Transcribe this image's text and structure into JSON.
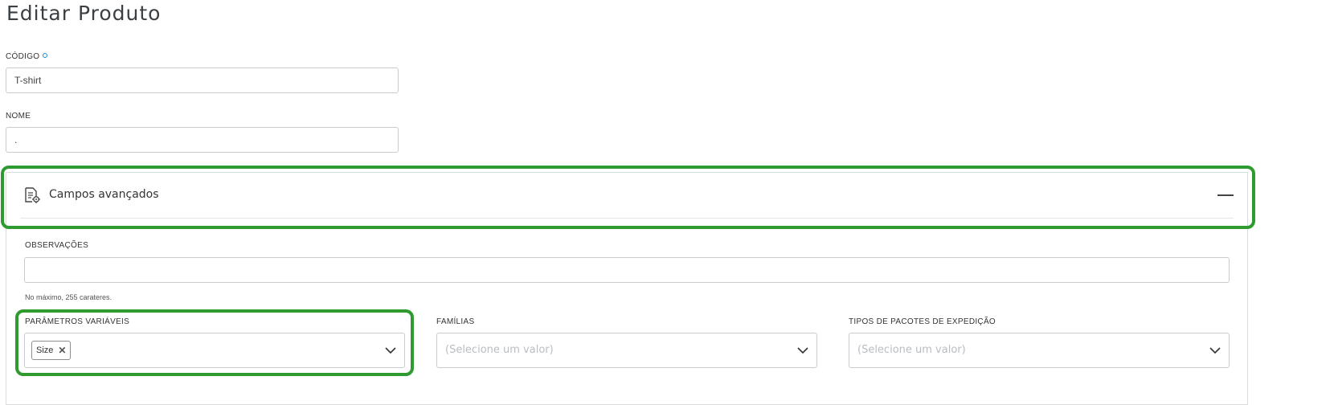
{
  "page": {
    "title": "Editar Produto"
  },
  "fields": {
    "codigo": {
      "label": "CÓDIGO",
      "value": "T-shirt"
    },
    "nome": {
      "label": "NOME",
      "value": "."
    }
  },
  "advanced": {
    "title": "Campos avançados",
    "icon": "settings-document-icon",
    "observacoes": {
      "label": "OBSERVAÇÕES",
      "value": "",
      "help": "No máximo, 255 carateres."
    },
    "parametros": {
      "label": "PARÂMETROS VARIÁVEIS",
      "tags": [
        "Size"
      ]
    },
    "familias": {
      "label": "FAMÍLIAS",
      "placeholder": "(Selecione um valor)"
    },
    "tipos": {
      "label": "TIPOS DE PACOTES DE EXPEDIÇÃO",
      "placeholder": "(Selecione um valor)"
    }
  },
  "colors": {
    "highlight": "#2f9a2f",
    "required": "#1a8fd6"
  }
}
